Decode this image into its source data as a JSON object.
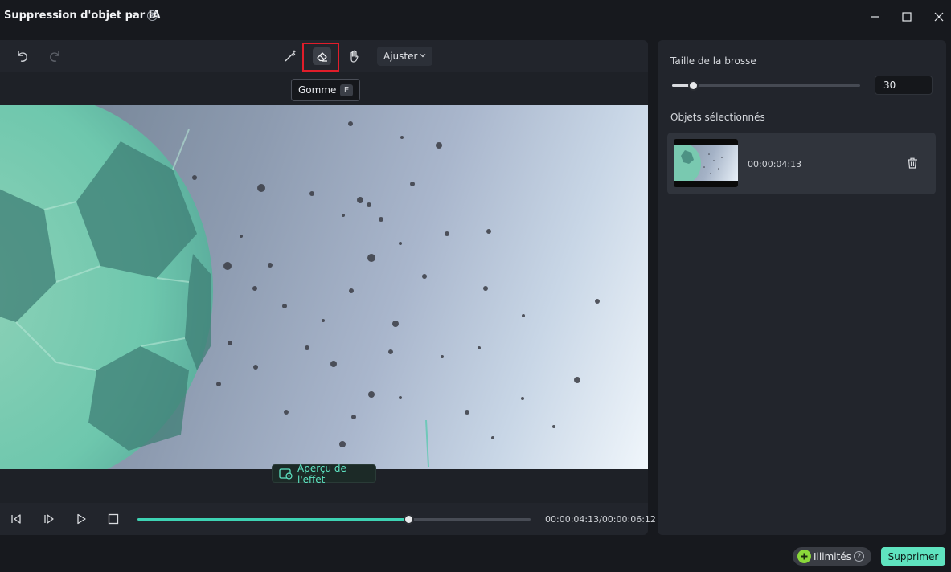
{
  "window": {
    "title": "Suppression d'objet par IA"
  },
  "toolbar": {
    "fit_dropdown": "Ajuster",
    "tooltip": {
      "label": "Gomme",
      "shortcut": "E"
    }
  },
  "preview": {
    "effect_button": "Aperçu de l'effet"
  },
  "playback": {
    "time": "00:00:04:13/00:00:06:12",
    "progress": 0.69
  },
  "brush": {
    "label": "Taille de la brosse",
    "value": "30",
    "level": 0.11
  },
  "objects": {
    "label": "Objets sélectionnés",
    "items": [
      {
        "time": "00:00:04:13"
      }
    ]
  },
  "footer": {
    "unlimited_label": "Illimités",
    "delete_label": "Supprimer"
  },
  "colors": {
    "accent": "#5fe3bf",
    "progress": "#3ed3b4",
    "highlight": "#e11d2a"
  }
}
